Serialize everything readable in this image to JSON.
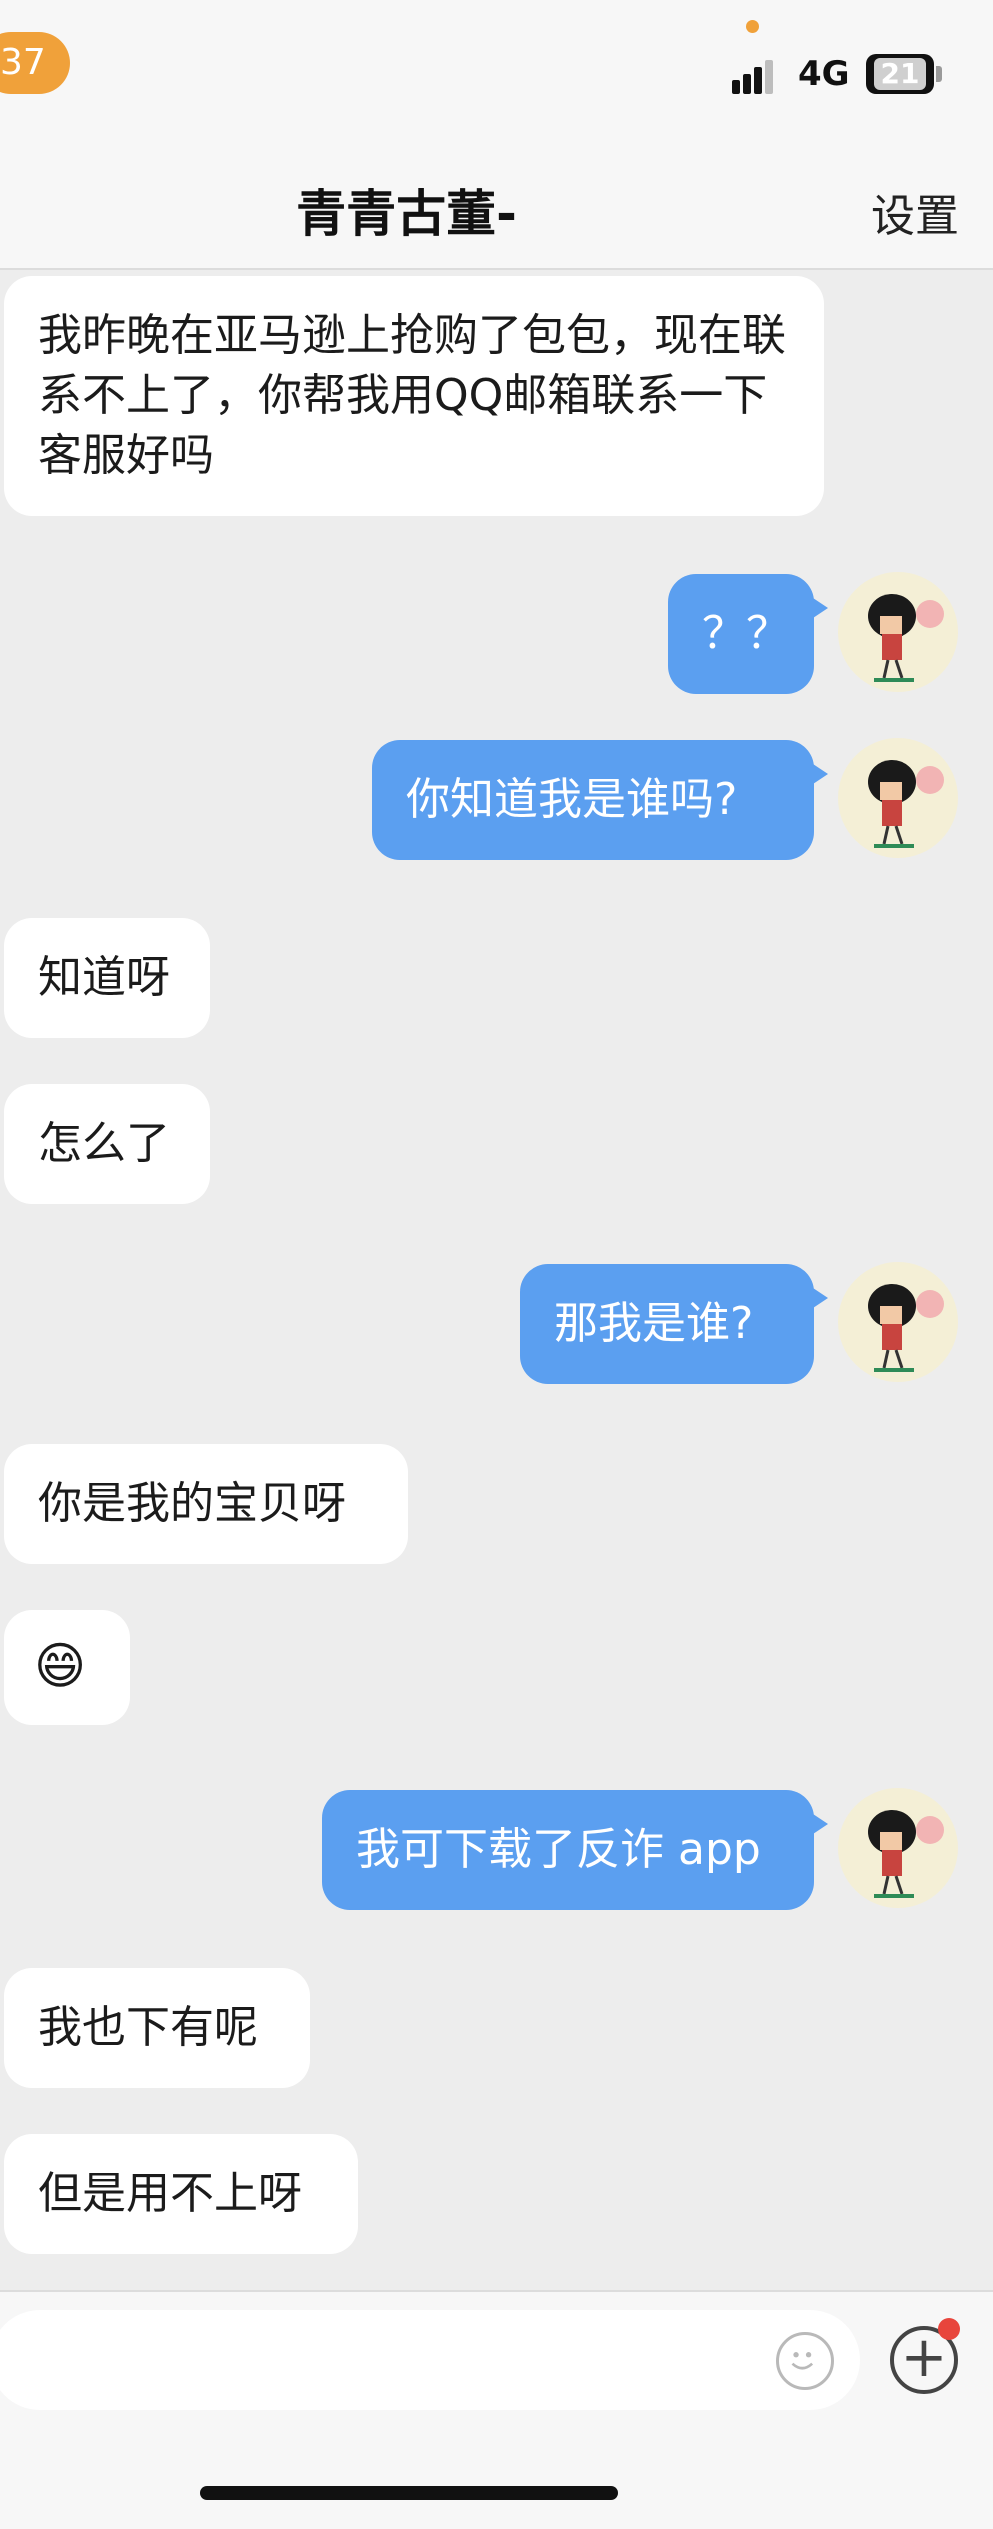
{
  "status_bar": {
    "back_count": "37",
    "network": "4G",
    "battery": "21"
  },
  "header": {
    "title": "青青古董-",
    "settings_label": "设置"
  },
  "messages": [
    {
      "side": "in",
      "text": "我昨晚在亚马逊上抢购了包包，现在联系不上了，你帮我用QQ邮箱联系一下客服好吗"
    },
    {
      "side": "out",
      "text": "？？"
    },
    {
      "side": "out",
      "text": "你知道我是谁吗?"
    },
    {
      "side": "in",
      "text": "知道呀"
    },
    {
      "side": "in",
      "text": "怎么了"
    },
    {
      "side": "out",
      "text": "那我是谁?"
    },
    {
      "side": "in",
      "text": "你是我的宝贝呀"
    },
    {
      "side": "in",
      "text": "😄"
    },
    {
      "side": "out",
      "text": "我可下载了反诈 app"
    },
    {
      "side": "in",
      "text": "我也下有呢"
    },
    {
      "side": "in",
      "text": "但是用不上呀"
    }
  ],
  "input_bar": {
    "placeholder": "",
    "emoji_icon": "smiley-face-icon",
    "plus_icon": "add-circle-icon",
    "notification_color": "#e8453c"
  },
  "colors": {
    "accent": "#5b9ff0",
    "badge": "#f0a13a",
    "incoming_bubble": "#ffffff",
    "background": "#ededed"
  }
}
